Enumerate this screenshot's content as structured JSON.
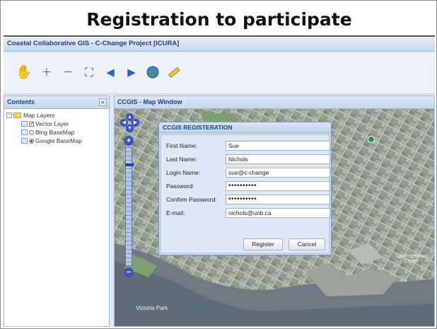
{
  "slide": {
    "title": "Registration to participate"
  },
  "app": {
    "title": "Coastal Collaborative GIS - C-Change Project [ICURA]",
    "toolbar": {
      "tools": [
        {
          "icon": "pan-hand-icon",
          "glyph": "✋"
        },
        {
          "icon": "zoom-in-icon",
          "glyph": "🔍"
        },
        {
          "icon": "zoom-out-icon",
          "glyph": "🔎"
        },
        {
          "icon": "zoom-box-icon",
          "glyph": "⛶"
        },
        {
          "icon": "back-arrow-icon",
          "glyph": "◀"
        },
        {
          "icon": "forward-arrow-icon",
          "glyph": "▶"
        },
        {
          "icon": "globe-icon",
          "glyph": "🌐"
        },
        {
          "icon": "measure-icon",
          "glyph": "📏"
        }
      ]
    },
    "contents": {
      "title": "Contents",
      "collapse_glyph": "«",
      "root": "Map Layers",
      "layers": [
        {
          "label": "Vector Layer",
          "control": "checkbox",
          "checked": true
        },
        {
          "label": "Bing BaseMap",
          "control": "radio",
          "checked": false
        },
        {
          "label": "Google BaseMap",
          "control": "radio",
          "checked": true
        }
      ]
    },
    "map_window": {
      "title": "CCGIS - Map Window",
      "labels": [
        "Victoria Park",
        "Confederation Centre"
      ]
    },
    "dialog": {
      "title": "CCGIS REGISTERATION",
      "fields": [
        {
          "label": "First Name:",
          "value": "Sue"
        },
        {
          "label": "Last Name:",
          "value": "Nichols"
        },
        {
          "label": "Login Name:",
          "value": "sue@c-change"
        },
        {
          "label": "Password:",
          "value": "••••••••••"
        },
        {
          "label": "Confirm Password:",
          "value": "••••••••••"
        },
        {
          "label": "E-mail:",
          "value": "nichols@unb.ca"
        }
      ],
      "register_label": "Register",
      "cancel_label": "Cancel"
    }
  }
}
